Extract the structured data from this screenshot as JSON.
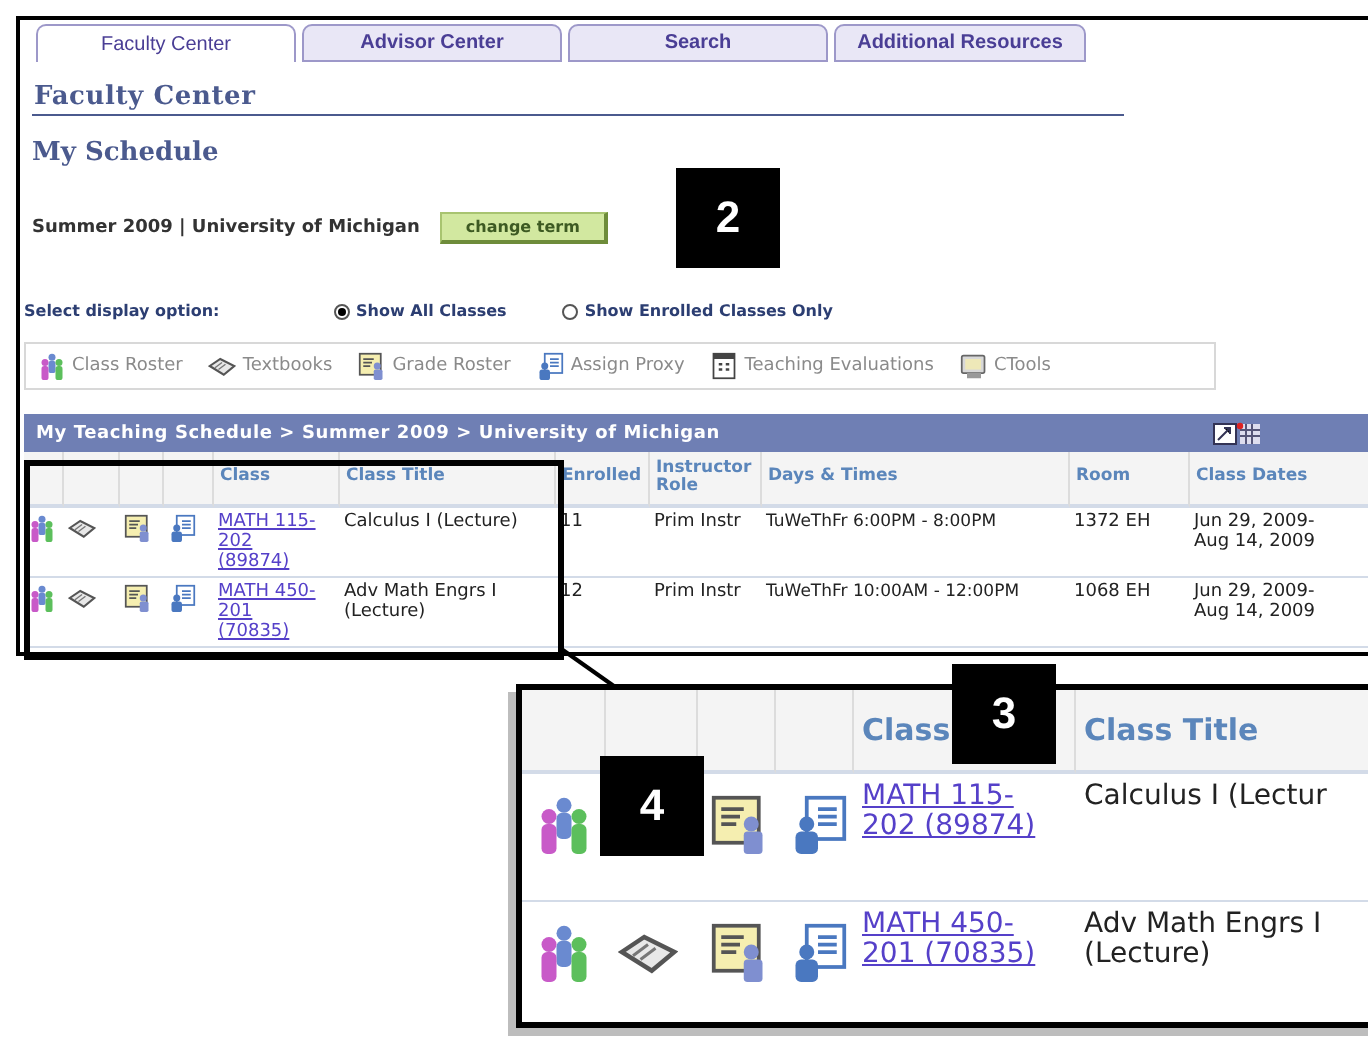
{
  "tabs": [
    {
      "label": "Faculty Center",
      "selected": true
    },
    {
      "label": "Advisor Center",
      "selected": false
    },
    {
      "label": "Search",
      "selected": false
    },
    {
      "label": "Additional Resources",
      "selected": false
    }
  ],
  "page_title": "Faculty Center",
  "section_title": "My Schedule",
  "term": "Summer 2009 | University of Michigan",
  "change_term_button": "change term",
  "display_option": {
    "label": "Select display option:",
    "options": [
      {
        "label": "Show All Classes",
        "selected": true
      },
      {
        "label": "Show Enrolled Classes Only",
        "selected": false
      }
    ]
  },
  "toolbar": [
    {
      "kind": "roster",
      "label": "Class Roster"
    },
    {
      "kind": "textbook",
      "label": "Textbooks"
    },
    {
      "kind": "grade",
      "label": "Grade Roster"
    },
    {
      "kind": "proxy",
      "label": "Assign Proxy"
    },
    {
      "kind": "eval",
      "label": "Teaching Evaluations"
    },
    {
      "kind": "ctools",
      "label": "CTools"
    }
  ],
  "table": {
    "title": "My Teaching Schedule > Summer 2009 > University of Michigan",
    "columns": [
      "Class",
      "Class Title",
      "Enrolled",
      "Instructor Role",
      "Days & Times",
      "Room",
      "Class Dates"
    ],
    "rows": [
      {
        "class": "MATH 115-202 (89874)",
        "title": "Calculus I (Lecture)",
        "enrolled": "11",
        "role": "Prim Instr",
        "days_times": "TuWeThFr 6:00PM - 8:00PM",
        "room": "1372 EH",
        "dates": "Jun 29, 2009-Aug 14, 2009"
      },
      {
        "class": "MATH 450-201 (70835)",
        "title": "Adv Math Engrs I (Lecture)",
        "enrolled": "12",
        "role": "Prim Instr",
        "days_times": "TuWeThFr 10:00AM - 12:00PM",
        "room": "1068 EH",
        "dates": "Jun 29, 2009-Aug 14, 2009"
      }
    ]
  },
  "magnified_view": {
    "columns": [
      "Class",
      "Class Title"
    ],
    "rows": [
      {
        "class": "MATH 115-202 (89874)",
        "title": "Calculus I (Lectur",
        "textbook_visible": false
      },
      {
        "class": "MATH 450-201 (70835)",
        "title": "Adv Math Engrs I (Lecture)",
        "textbook_visible": true
      }
    ]
  },
  "callouts": [
    "2",
    "3",
    "4"
  ]
}
